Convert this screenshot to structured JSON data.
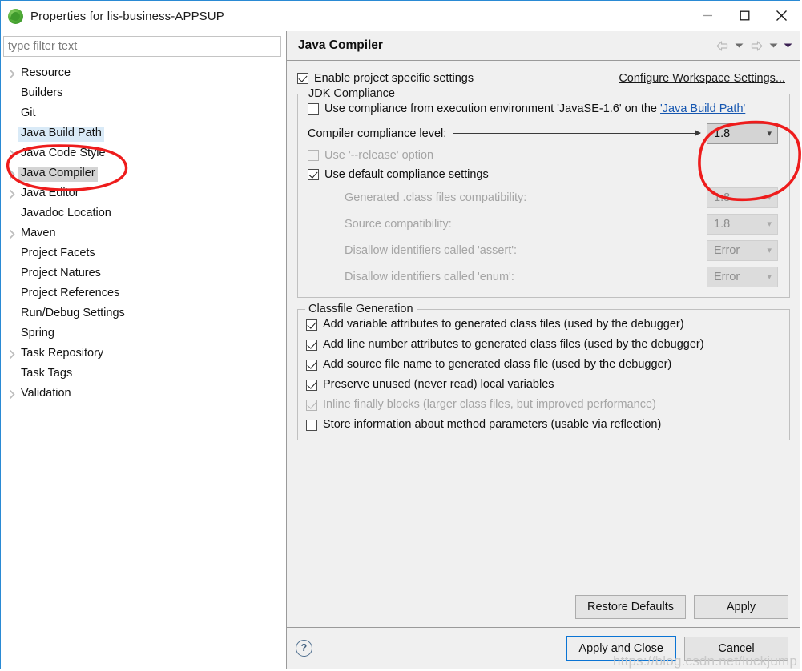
{
  "window": {
    "title": "Properties for lis-business-APPSUP",
    "icon": "eclipse-project-icon",
    "controls": {
      "minimize": "minimize-icon",
      "maximize": "maximize-icon",
      "close": "close-icon"
    }
  },
  "sidebar": {
    "filter": {
      "value": "",
      "placeholder": "type filter text"
    },
    "items": [
      {
        "label": "Resource",
        "expandable": true,
        "state": "normal"
      },
      {
        "label": "Builders",
        "expandable": false,
        "state": "normal"
      },
      {
        "label": "Git",
        "expandable": false,
        "state": "normal"
      },
      {
        "label": "Java Build Path",
        "expandable": false,
        "state": "highlight"
      },
      {
        "label": "Java Code Style",
        "expandable": true,
        "state": "normal"
      },
      {
        "label": "Java Compiler",
        "expandable": true,
        "state": "selected"
      },
      {
        "label": "Java Editor",
        "expandable": true,
        "state": "normal"
      },
      {
        "label": "Javadoc Location",
        "expandable": false,
        "state": "normal"
      },
      {
        "label": "Maven",
        "expandable": true,
        "state": "normal"
      },
      {
        "label": "Project Facets",
        "expandable": false,
        "state": "normal"
      },
      {
        "label": "Project Natures",
        "expandable": false,
        "state": "normal"
      },
      {
        "label": "Project References",
        "expandable": false,
        "state": "normal"
      },
      {
        "label": "Run/Debug Settings",
        "expandable": false,
        "state": "normal"
      },
      {
        "label": "Spring",
        "expandable": false,
        "state": "normal"
      },
      {
        "label": "Task Repository",
        "expandable": true,
        "state": "normal"
      },
      {
        "label": "Task Tags",
        "expandable": false,
        "state": "normal"
      },
      {
        "label": "Validation",
        "expandable": true,
        "state": "normal"
      }
    ]
  },
  "page": {
    "title": "Java Compiler",
    "nav": {
      "back": "back-arrow-icon",
      "back_menu": "chevron-down-icon",
      "forward": "forward-arrow-icon",
      "forward_menu": "chevron-down-icon",
      "view_menu": "chevron-down-icon"
    },
    "enable_project_specific": {
      "label": "Enable project specific settings",
      "checked": true
    },
    "configure_workspace_link": "Configure Workspace Settings...",
    "jdk_compliance": {
      "legend": "JDK Compliance",
      "use_execution_environment": {
        "label_prefix": "Use compliance from execution environment 'JavaSE-1.6' on the ",
        "link": "'Java Build Path'",
        "checked": false
      },
      "compiler_compliance_level": {
        "label": "Compiler compliance level:",
        "value": "1.8",
        "enabled": true
      },
      "use_release_option": {
        "label": "Use '--release' option",
        "checked": false,
        "enabled": false
      },
      "use_default_compliance": {
        "label": "Use default compliance settings",
        "checked": true,
        "enabled": true
      },
      "disabled_fields": [
        {
          "label": "Generated .class files compatibility:",
          "value": "1.8"
        },
        {
          "label": "Source compatibility:",
          "value": "1.8"
        },
        {
          "label": "Disallow identifiers called 'assert':",
          "value": "Error"
        },
        {
          "label": "Disallow identifiers called 'enum':",
          "value": "Error"
        }
      ]
    },
    "classfile_generation": {
      "legend": "Classfile Generation",
      "options": [
        {
          "label": "Add variable attributes to generated class files (used by the debugger)",
          "checked": true,
          "enabled": true
        },
        {
          "label": "Add line number attributes to generated class files (used by the debugger)",
          "checked": true,
          "enabled": true
        },
        {
          "label": "Add source file name to generated class file (used by the debugger)",
          "checked": true,
          "enabled": true
        },
        {
          "label": "Preserve unused (never read) local variables",
          "checked": true,
          "enabled": true
        },
        {
          "label": "Inline finally blocks (larger class files, but improved performance)",
          "checked": true,
          "enabled": false
        },
        {
          "label": "Store information about method parameters (usable via reflection)",
          "checked": false,
          "enabled": true
        }
      ]
    },
    "buttons": {
      "restore_defaults": "Restore Defaults",
      "apply": "Apply"
    }
  },
  "footer": {
    "help": "?",
    "apply_and_close": "Apply and Close",
    "cancel": "Cancel"
  },
  "annotations": {
    "color": "#ee1c1c",
    "sidebar_circle": "red-ellipse-around-java-compiler",
    "combo_circle": "red-ellipse-around-compliance-level"
  },
  "watermark": "https://blog.csdn.net/luckjump"
}
